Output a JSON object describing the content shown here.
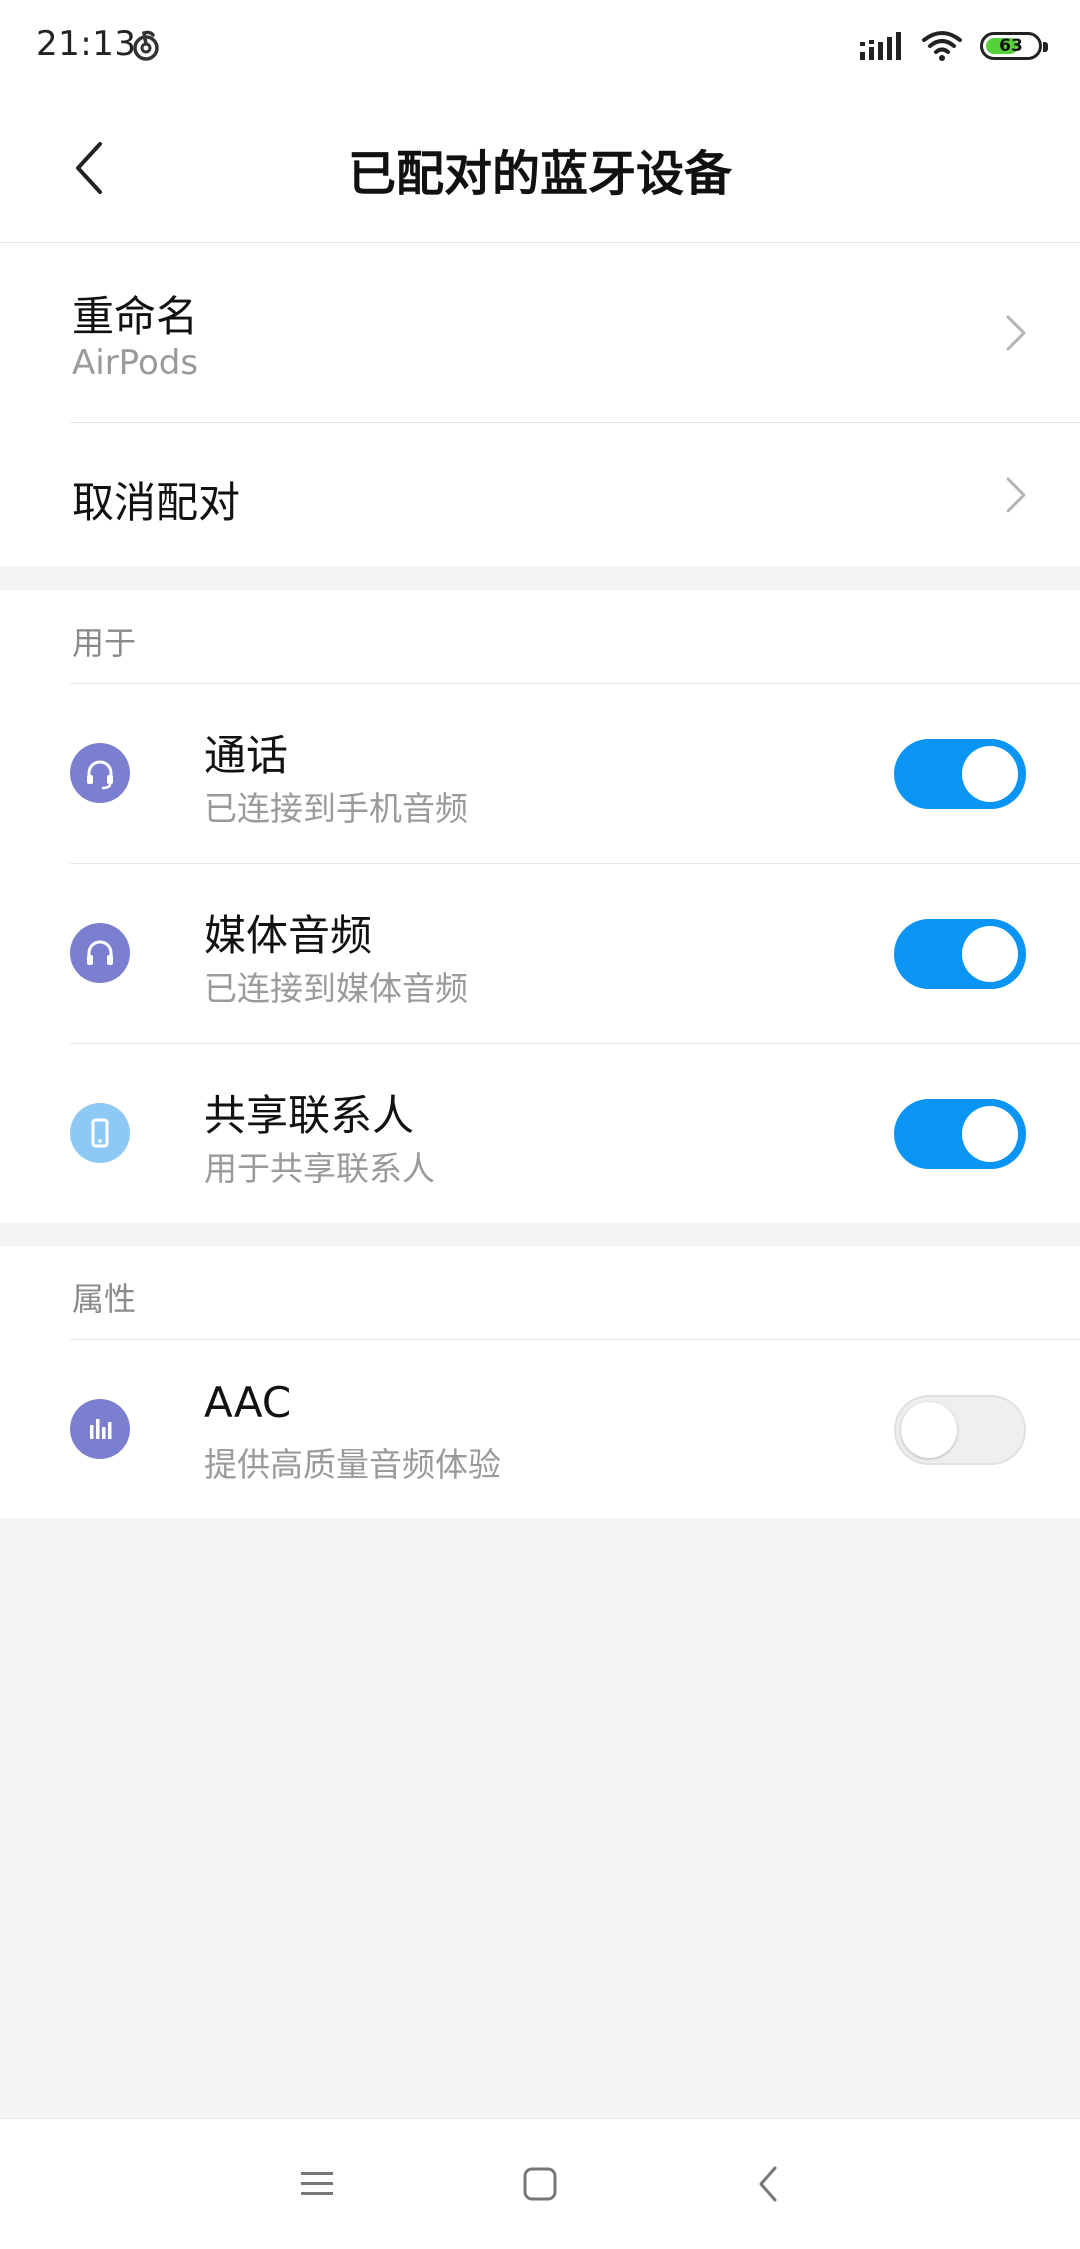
{
  "status_bar": {
    "time": "21:13",
    "battery_level": "63",
    "battery_fraction": 0.63,
    "accent_color": "#57d13a"
  },
  "header": {
    "title": "已配对的蓝牙设备",
    "back_icon": "chevron-left-icon"
  },
  "device": {
    "rename_label": "重命名",
    "device_name": "AirPods",
    "unpair_label": "取消配对"
  },
  "usage_section": {
    "header": "用于",
    "items": [
      {
        "title": "通话",
        "subtitle": "已连接到手机音频",
        "icon": "headset-icon",
        "icon_color": "#7b7fcf",
        "enabled": true
      },
      {
        "title": "媒体音频",
        "subtitle": "已连接到媒体音频",
        "icon": "headphones-icon",
        "icon_color": "#7b7fcf",
        "enabled": true
      },
      {
        "title": "共享联系人",
        "subtitle": "用于共享联系人",
        "icon": "phone-icon",
        "icon_color": "#8ec9f5",
        "enabled": true
      }
    ]
  },
  "properties_section": {
    "header": "属性",
    "items": [
      {
        "title": "AAC",
        "subtitle": "提供高质量音频体验",
        "icon": "equalizer-icon",
        "icon_color": "#7b7fcf",
        "enabled": false
      }
    ]
  },
  "nav_bar": {
    "menu_icon": "menu-icon",
    "home_icon": "home-square-icon",
    "back_icon": "back-triangle-icon"
  },
  "colors": {
    "toggle_on": "#0a95f5",
    "toggle_off": "#efefef",
    "background": "#f5f5f5"
  }
}
